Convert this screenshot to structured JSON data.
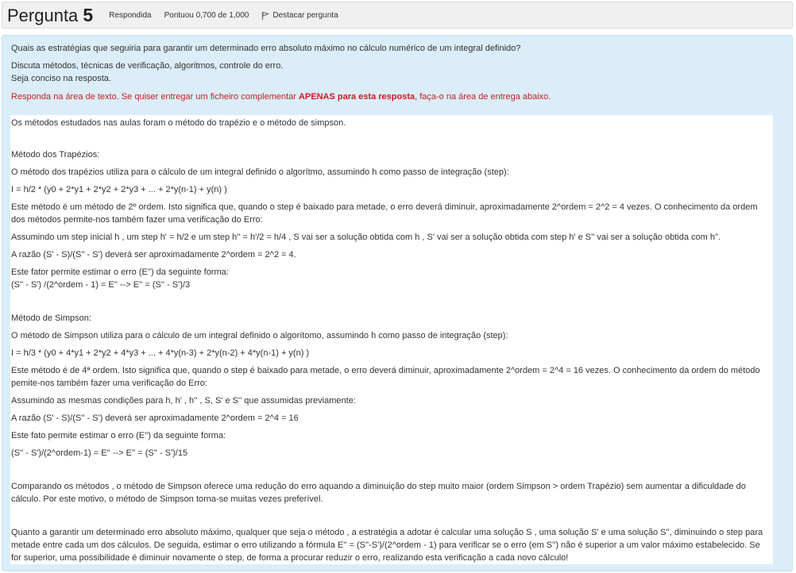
{
  "header": {
    "title_word": "Pergunta",
    "number": "5",
    "status": "Respondida",
    "grade": "Pontuou 0,700 de 1,000",
    "flag_label": "Destacar pergunta"
  },
  "question": {
    "line1": "Quais as estratégias que seguiria para garantir um determinado erro absoluto máximo no cálculo numérico de um integral definido?",
    "line2": "Discuta métodos, técnicas de verificação, algoritmos, controle do erro.",
    "line3": "Seja conciso na resposta.",
    "instruction_pre": "Responda na área de texto. Se quiser entregar um ficheiro complementar ",
    "instruction_bold": "APENAS para esta resposta",
    "instruction_post": ", faça-o na área de entrega abaixo."
  },
  "answer": {
    "p1": "Os métodos estudados nas aulas foram o método do trapézio e o método de simpson.",
    "trap_title": "Método dos Trapézios:",
    "trap_p1": "O método dos trapézios utiliza para o cálculo de um integral definido o algorítmo, assumindo h como passo de integração (step):",
    "trap_formula": "I = h/2 * (y0 + 2*y1 + 2*y2 + 2*y3 + ... + 2*y(n-1) + y(n) )",
    "trap_p2": "Este método é um método de 2º ordem. Isto significa que, quando o step é baixado para metade, o erro deverá diminuir, aproximadamente 2^ordem = 2^2 = 4 vezes. O conhecimento da ordem dos métodos permite-nos também fazer uma verificação do Erro:",
    "trap_p3": "Assumindo um step inicial h , um step h' = h/2 e um step h'' = h'/2 = h/4 , S vai ser a solução obtida com h , S' vai ser a solução obtida com step h' e S'' vai ser a solução obtida com h''.",
    "trap_p4": "A razão (S' - S)/(S'' - S') deverá ser aproximadamente 2^ordem = 2^2 = 4.",
    "trap_p5a": "Este fator permite estimar o erro (E'') da seguinte forma:",
    "trap_p5b": "(S'' - S') /(2^ordem - 1) = E''      -->   E'' = (S'' - S')/3",
    "simp_title": "Método de Simpson:",
    "simp_p1": "O método de Simpson utiliza para o cálculo de um integral definido o algorítomo, assumindo h como passo de integração (step):",
    "simp_formula": "I = h/3 * (y0 + 4*y1 + 2*y2 + 4*y3 + ... + 4*y(n-3) + 2*y(n-2) + 4*y(n-1) + y(n) )",
    "simp_p2": "Este método é de 4ª ordem. Isto significa que, quando o step é baixado para metade, o erro deverá diminuir, aproximadamente 2^ordem = 2^4 = 16 vezes. O conhecimento da ordem do método pemite-nos também fazer uma verificação do Erro:",
    "simp_p3": "Assumindo as mesmas condições para h, h' , h'' , S, S' e S'' que assumidas previamente:",
    "simp_p4": "A razão (S' - S)/(S'' - S') deverá ser aproximadamente 2^ordem = 2^4 = 16",
    "simp_p5": "Este fato permite estimar o erro (E'') da seguinte forma:",
    "simp_p6": "(S'' - S')/(2^ordem-1) = E''    -->   E'' = (S'' - S')/15",
    "compare": "Comparando os métodos , o método de Simpson oferece uma redução do erro aquando a diminuição do step muito maior (ordem Simpson > ordem Trapézio) sem aumentar a dificuldade do cálculo. Por este motivo, o método de Simpson torna-se muitas vezes preferível.",
    "conclusion": "Quanto a garantir um determinado erro absoluto máximo, qualquer que seja o método , a estratégia a adotar é calcular uma solução S , uma solução S' e uma solução S'', diminuindo o step para metade entre cada um dos cálculos. De seguida, estimar o erro utilizando a fórmula E'' = (S''-S')/(2^ordem - 1) para verificar se o erro (em S'') não é superior a um valor máximo estabelecido. Se for superior, uma possibilidade é diminuir novamente o step, de forma a procurar reduzir o erro, realizando esta verificação a cada novo cálculo!"
  },
  "colors": {
    "header_bg": "#f0f0f0",
    "panel_bg": "#dbedf8",
    "instruction": "#cc1b22"
  },
  "icons": {
    "flag": "flag-icon"
  }
}
